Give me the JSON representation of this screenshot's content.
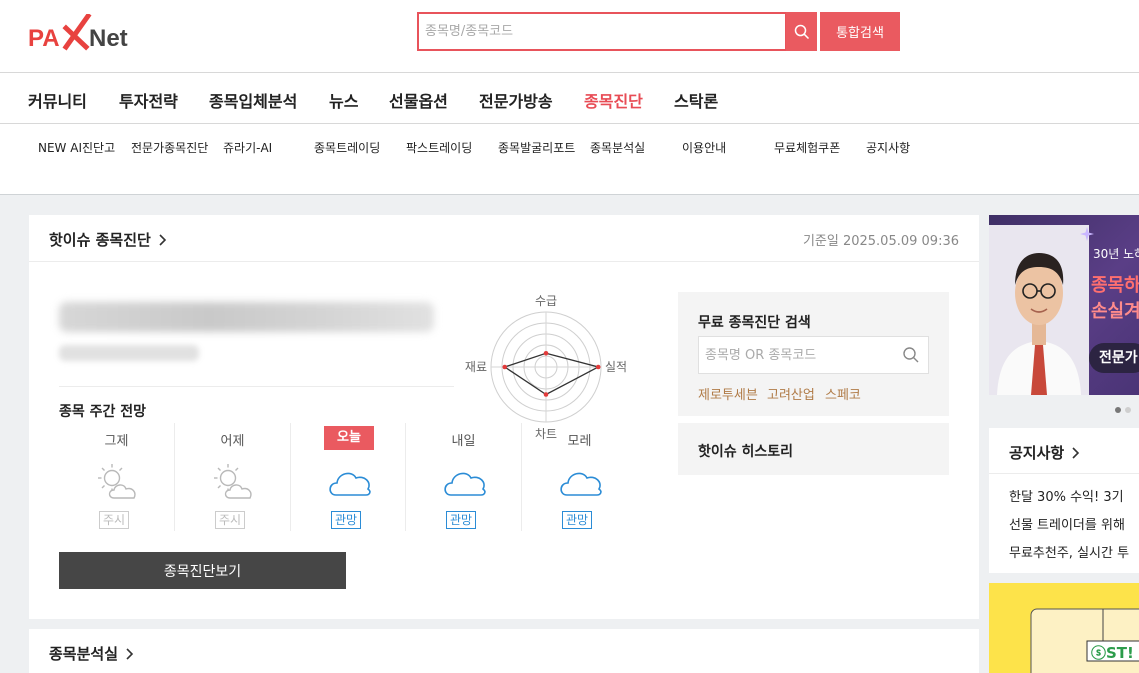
{
  "header": {
    "logo_text": "PAXNet",
    "search_placeholder": "종목명/종목코드",
    "unified_search_label": "통합검색",
    "search_icon": "search-icon"
  },
  "main_nav": [
    {
      "label": "커뮤니티",
      "active": false
    },
    {
      "label": "투자전략",
      "active": false
    },
    {
      "label": "종목입체분석",
      "active": false
    },
    {
      "label": "뉴스",
      "active": false
    },
    {
      "label": "선물옵션",
      "active": false
    },
    {
      "label": "전문가방송",
      "active": false
    },
    {
      "label": "종목진단",
      "active": true
    },
    {
      "label": "스탁론",
      "active": false
    }
  ],
  "sub_nav": [
    "NEW AI진단고",
    "전문가종목진단",
    "쥬라기-AI",
    "종목트레이딩",
    "팍스트레이딩",
    "종목발굴리포트",
    "종목분석실",
    "이용안내",
    "무료체험쿠폰",
    "공지사항"
  ],
  "hot_issue": {
    "title": "핫이슈 종목진단",
    "date": "기준일 2025.05.09 09:36",
    "weekly_title": "종목 주간 전망",
    "days": [
      {
        "label": "그제",
        "status": "주시",
        "weather": "sun-cloud-icon",
        "today": false,
        "color": "grey"
      },
      {
        "label": "어제",
        "status": "주시",
        "weather": "sun-cloud-icon",
        "today": false,
        "color": "grey"
      },
      {
        "label": "오늘",
        "status": "관망",
        "weather": "cloud-icon",
        "today": true,
        "color": "blue"
      },
      {
        "label": "내일",
        "status": "관망",
        "weather": "cloud-icon",
        "today": false,
        "color": "blue"
      },
      {
        "label": "모레",
        "status": "관망",
        "weather": "cloud-icon",
        "today": false,
        "color": "blue"
      }
    ],
    "view_button": "종목진단보기",
    "radar": {
      "axes": [
        "수급",
        "실적",
        "차트",
        "재료"
      ],
      "values": [
        0.25,
        0.95,
        0.5,
        0.75
      ]
    }
  },
  "free_search": {
    "title": "무료 종목진단 검색",
    "placeholder": "종목명 OR 종목코드",
    "links": [
      "제로투세븐",
      "고려산업",
      "스페코"
    ]
  },
  "history": {
    "title": "핫이슈 히스토리"
  },
  "analysis": {
    "title": "종목분석실"
  },
  "ad": {
    "line1": "30년 노하",
    "line2": "종목하",
    "line3": "손실겨",
    "line4": "전문가"
  },
  "notice": {
    "title": "공지사항",
    "items": [
      "한달 30% 수익! 3기 ",
      "선물 트레이더를 위해",
      "무료추천주, 실시간 투"
    ]
  },
  "ad2": {
    "text": "ⓢST!"
  },
  "colors": {
    "accent": "#ea5a60",
    "active_nav": "#e84c55",
    "blue_status": "#2b8cd6",
    "link_brown": "#b07b47"
  }
}
